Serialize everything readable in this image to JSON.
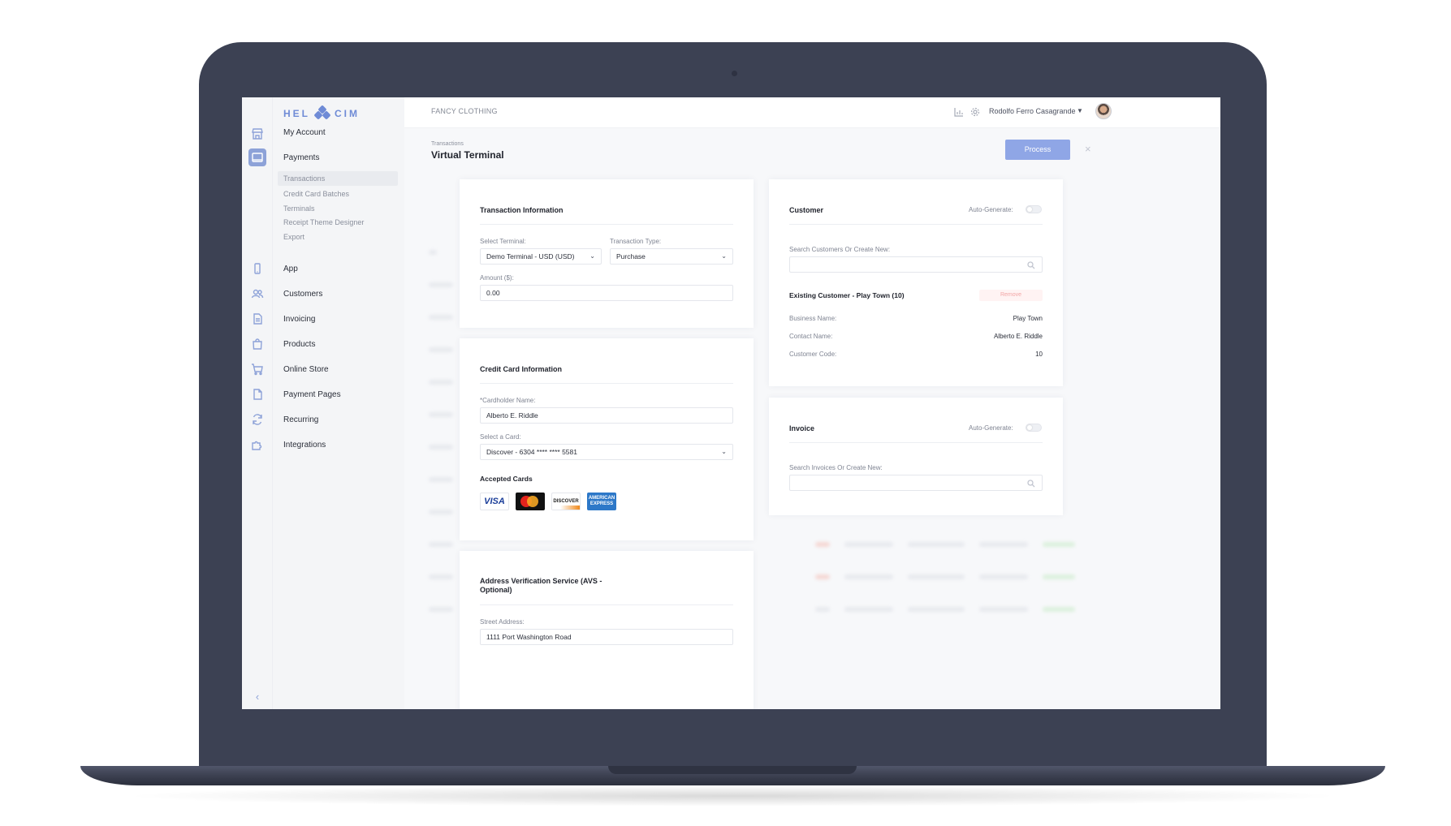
{
  "brand": {
    "logo_left": "HEL",
    "logo_right": "CIM"
  },
  "header": {
    "company": "FANCY CLOTHING",
    "user_name": "Rodolfo Ferro Casagrande",
    "icons": [
      "chart-icon",
      "settings-icon",
      "chevron-down-icon"
    ]
  },
  "sidebar": {
    "items": [
      {
        "label": "My Account",
        "icon": "store-icon"
      },
      {
        "label": "Payments",
        "icon": "payments-icon",
        "active": true,
        "children": [
          "Transactions",
          "Credit Card Batches",
          "Terminals",
          "Receipt Theme Designer",
          "Export"
        ],
        "active_child": "Transactions"
      },
      {
        "label": "App",
        "icon": "phone-icon"
      },
      {
        "label": "Customers",
        "icon": "users-icon"
      },
      {
        "label": "Invoicing",
        "icon": "document-icon"
      },
      {
        "label": "Products",
        "icon": "bag-icon"
      },
      {
        "label": "Online Store",
        "icon": "cart-icon"
      },
      {
        "label": "Payment Pages",
        "icon": "page-icon"
      },
      {
        "label": "Recurring",
        "icon": "refresh-icon"
      },
      {
        "label": "Integrations",
        "icon": "puzzle-icon"
      }
    ],
    "collapse_glyph": "‹"
  },
  "page": {
    "breadcrumb": "Transactions",
    "title": "Virtual Terminal",
    "process_label": "Process",
    "close_glyph": "×"
  },
  "transaction": {
    "title": "Transaction Information",
    "terminal_label": "Select Terminal:",
    "terminal_value": "Demo Terminal - USD (USD)",
    "type_label": "Transaction Type:",
    "type_value": "Purchase",
    "amount_label": "Amount ($):",
    "amount_value": "0.00"
  },
  "credit_card": {
    "title": "Credit Card Information",
    "cardholder_label": "*Cardholder Name:",
    "cardholder_value": "Alberto E. Riddle",
    "card_label": "Select a Card:",
    "card_value": "Discover - 6304 **** **** 5581",
    "accepted_label": "Accepted Cards",
    "cards": [
      "VISA",
      "mastercard",
      "DISCOVER",
      "AMERICAN EXPRESS"
    ]
  },
  "avs": {
    "title": "Address Verification Service (AVS - Optional)",
    "title_line1": "Address Verification Service (AVS -",
    "title_line2": "Optional)",
    "street_label": "Street Address:",
    "street_value": "1111 Port Washington Road"
  },
  "customer": {
    "title": "Customer",
    "auto_label": "Auto-Generate:",
    "search_label": "Search Customers Or Create New:",
    "existing_title": "Existing Customer - Play Town (10)",
    "remove_label": "Remove",
    "fields": [
      {
        "label": "Business Name:",
        "value": "Play Town"
      },
      {
        "label": "Contact Name:",
        "value": "Alberto E. Riddle"
      },
      {
        "label": "Customer Code:",
        "value": "10"
      }
    ]
  },
  "invoice": {
    "title": "Invoice",
    "auto_label": "Auto-Generate:",
    "search_label": "Search Invoices Or Create New:"
  },
  "help_label": "?"
}
